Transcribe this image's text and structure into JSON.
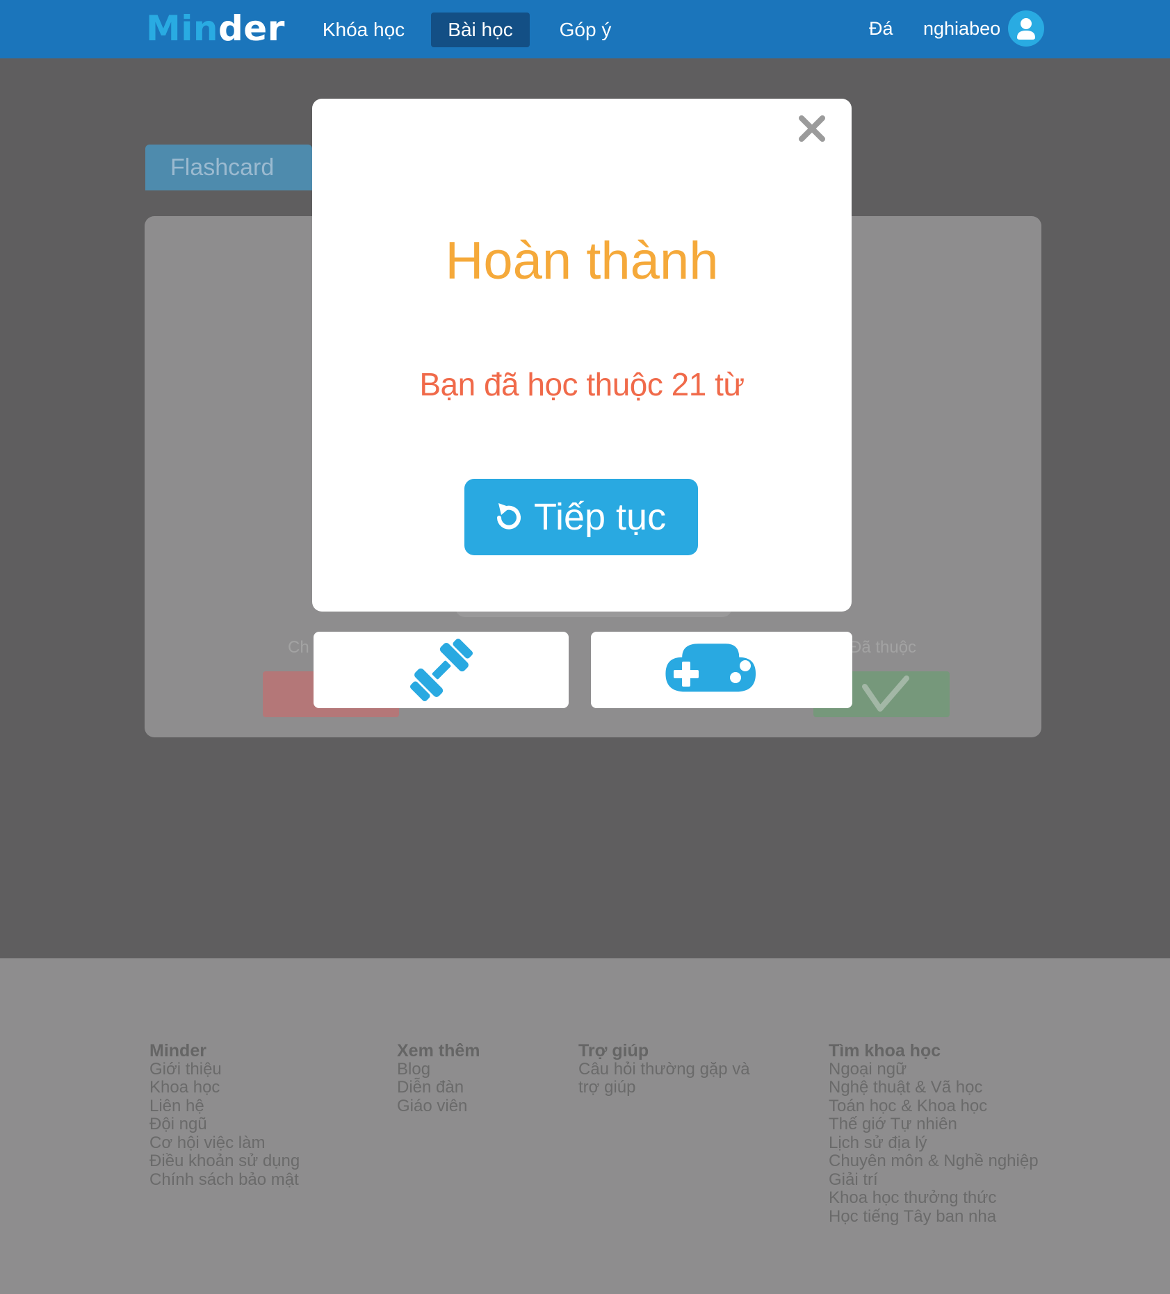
{
  "header": {
    "logo_part1": "Min",
    "logo_part2": "der",
    "nav": [
      {
        "label": "Khóa học",
        "active": false
      },
      {
        "label": "Bài học",
        "active": true
      },
      {
        "label": "Góp ý",
        "active": false
      }
    ],
    "user_short": "Đá",
    "username": "nghiabeo"
  },
  "background": {
    "tab_label": "Flashcard",
    "label_left": "Ch",
    "label_right": "Đã thuộc"
  },
  "modal": {
    "title": "Hoàn thành",
    "message": "Bạn đã học thuộc 21 từ",
    "continue_label": "Tiếp tục"
  },
  "footer": {
    "columns": [
      {
        "heading": "Minder",
        "links": [
          "Giới thiệu",
          "Khoa học",
          "Liên hệ",
          "Đội ngũ",
          "Cơ hội việc làm",
          "Điều khoản sử dụng",
          "Chính sách bảo mật"
        ]
      },
      {
        "heading": "Xem thêm",
        "links": [
          "Blog",
          "Diễn đàn",
          "Giáo viên"
        ]
      },
      {
        "heading": "Trợ giúp",
        "links": [
          "Câu hỏi thường gặp và",
          "trợ giúp"
        ]
      },
      {
        "heading": "Tìm khoa học",
        "links": [
          "Ngoại ngữ",
          "Nghệ thuật & Vã học",
          "Toán học & Khoa học",
          "Thế giớ Tự nhiên",
          "Lịch sử địa lý",
          "Chuyên môn & Nghề nghiệp",
          "Giải trí",
          "Khoa học thưởng thức",
          "Học tiếng Tây ban nha"
        ]
      }
    ]
  },
  "colors": {
    "header_bg": "#1b75bb",
    "accent": "#29abe2",
    "title_orange": "#f5a93a",
    "message_red": "#f06a4a",
    "overlay": "#5f5e5f"
  },
  "icons": {
    "close": "close-icon",
    "refresh": "refresh-icon",
    "dumbbell": "dumbbell-icon",
    "gamepad": "gamepad-icon",
    "user": "user-icon",
    "check": "check-icon"
  }
}
